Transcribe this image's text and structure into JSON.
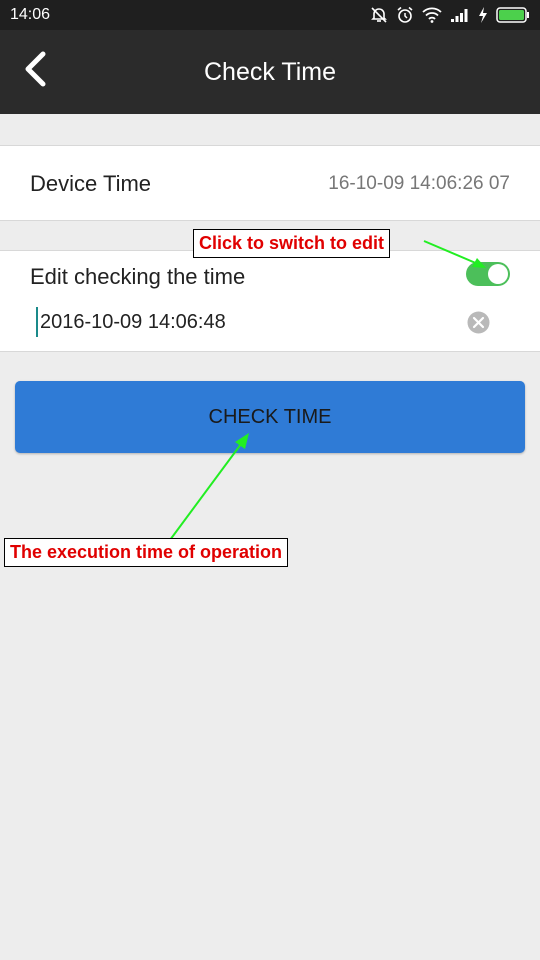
{
  "status_bar": {
    "time": "14:06",
    "icons": [
      "silent-icon",
      "alarm-icon",
      "wifi-icon",
      "signal-icon",
      "charging-icon",
      "battery-icon"
    ]
  },
  "toolbar": {
    "title": "Check Time",
    "back_icon": "chevron-left-icon"
  },
  "device_time": {
    "label": "Device Time",
    "value": "16-10-09 14:06:26 07"
  },
  "edit_time": {
    "label": "Edit checking the time",
    "toggle_on": true,
    "input_value": "2016-10-09 14:06:48",
    "clear_icon": "clear-icon"
  },
  "check_button": {
    "label": "CHECK TIME"
  },
  "annotations": {
    "switch": "Click to switch to edit",
    "execution": "The execution time of operation"
  },
  "colors": {
    "toolbar": "#2b2b2b",
    "status_bar": "#1f1f1f",
    "toggle": "#4cbf5a",
    "button": "#2f7bd6",
    "annotation_text": "#e00000",
    "arrow": "#22ee22",
    "background": "#ededed"
  }
}
